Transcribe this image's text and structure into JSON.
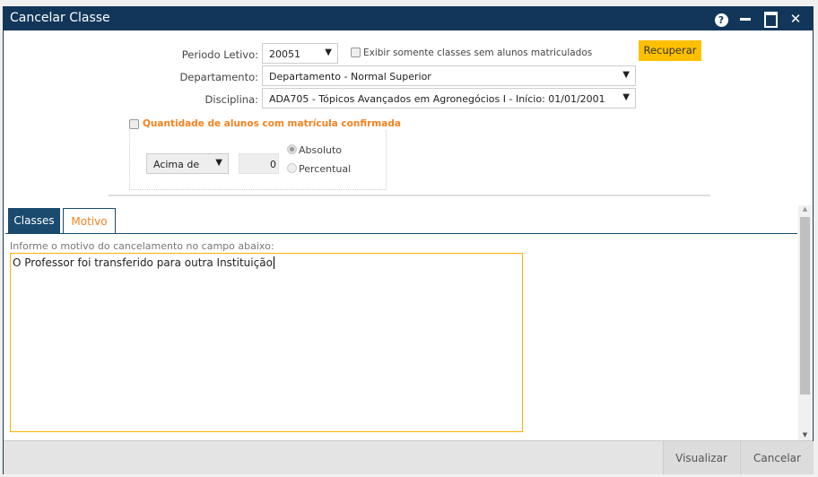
{
  "window": {
    "title": "Cancelar Classe",
    "icons": [
      "help-icon",
      "minimize-icon",
      "maximize-icon",
      "close-icon"
    ]
  },
  "form": {
    "periodo_label": "Periodo Letivo:",
    "periodo_value": "20051",
    "exibir_label": "Exibir somente classes sem alunos matriculados",
    "exibir_checked": false,
    "recuperar_label": "Recuperar",
    "departamento_label": "Departamento:",
    "departamento_value": "Departamento - Normal Superior",
    "disciplina_label": "Disciplina:",
    "disciplina_value": "ADA705 - Tópicos Avançados em Agronegócios I - Início: 01/01/2001",
    "quantidade_label": "Quantidade de alunos com matrícula confirmada",
    "quantidade_checked": false,
    "comparador_value": "Acima de",
    "quantidade_value": "0",
    "radio_absoluto": "Absoluto",
    "radio_percentual": "Percentual",
    "radio_selected": "Absoluto"
  },
  "tabs": [
    {
      "label": "Classes",
      "active": false
    },
    {
      "label": "Motivo",
      "active": true
    }
  ],
  "motivo": {
    "instruction": "Informe o motivo do cancelamento no campo abaixo:",
    "value": "O Professor foi transferido para outra Instituição"
  },
  "footer": {
    "visualizar_label": "Visualizar",
    "cancelar_label": "Cancelar"
  },
  "colors": {
    "navy": "#12365a",
    "accent": "#f58220",
    "button": "#ffc000"
  }
}
